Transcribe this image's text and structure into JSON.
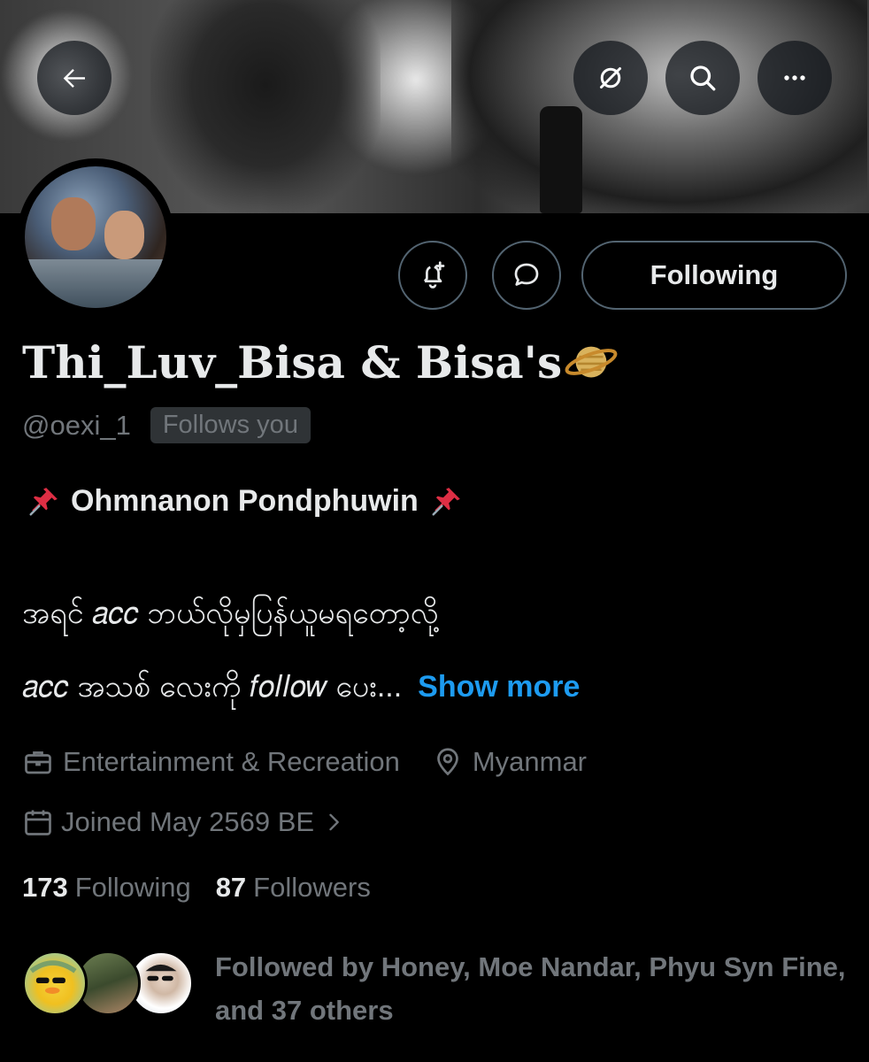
{
  "profile": {
    "display_name": "Thi_Luv_Bisa & Bisa's",
    "display_name_emoji": "ringed-planet-emoji",
    "handle": "@oexi_1",
    "follows_you_badge": "Follows you"
  },
  "actions": {
    "notify_icon": "bell-plus-icon",
    "message_icon": "chat-bubble-icon",
    "follow_label": "Following"
  },
  "nav": {
    "back_icon": "back-arrow-icon",
    "grok_icon": "grok-icon",
    "search_icon": "search-icon",
    "more_icon": "more-icon"
  },
  "bio": {
    "line1": "Ohmnanon Pondphuwin",
    "line1_emoji": "pushpin-emoji",
    "line2": "အရင် 𝑎𝑐𝑐 ဘယ်လိုမှပြန်ယူမရတော့လို့",
    "line3": " 𝑎𝑐𝑐 အသစ် လေးကို 𝑓𝑜𝑙𝑙𝑜𝑤 ပေး...",
    "show_more": "Show more"
  },
  "meta": {
    "category": "Entertainment & Recreation",
    "location": "Myanmar",
    "joined": "Joined May 2569 BE"
  },
  "stats": {
    "following_count": "173",
    "following_label": "Following",
    "followers_count": "87",
    "followers_label": "Followers"
  },
  "followed_by": {
    "text": "Followed by Honey, Moe Nandar, Phyu Syn Fine, and 37 others"
  },
  "colors": {
    "background": "#000000",
    "text_primary": "#e7e9ea",
    "text_secondary": "#71767b",
    "accent": "#1d9bf0",
    "border": "#536471"
  }
}
